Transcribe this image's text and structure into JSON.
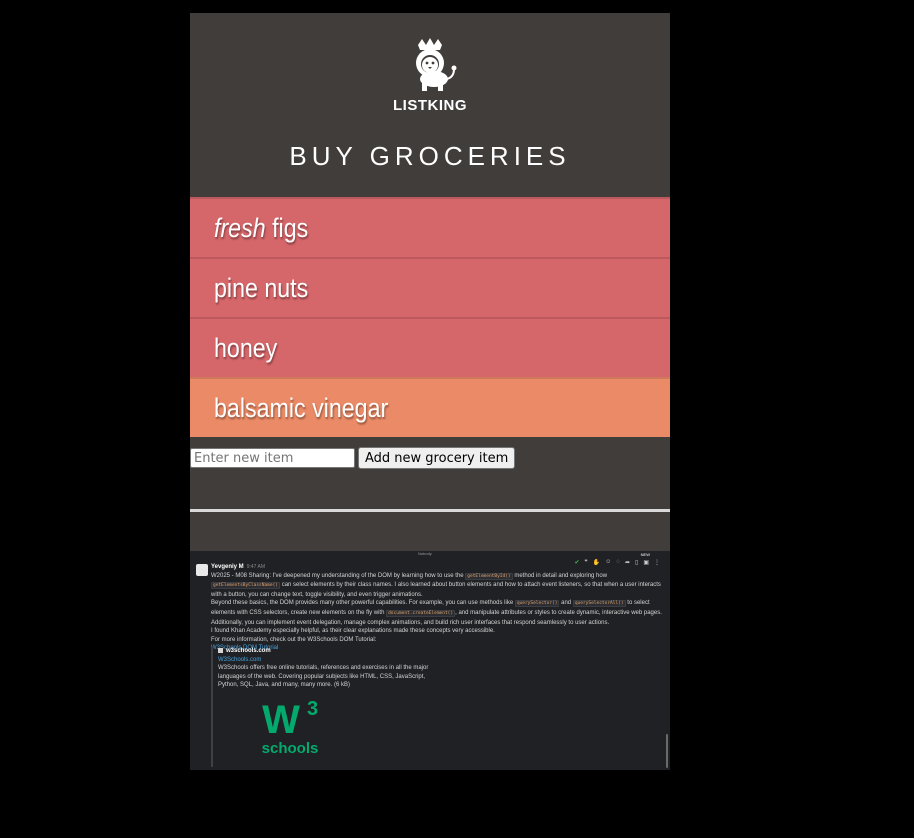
{
  "app": {
    "brand": "LISTKING",
    "title": "BUY GROCERIES",
    "items": [
      {
        "prefix": "fresh",
        "label": " figs",
        "color": "#d5666a"
      },
      {
        "prefix": "",
        "label": "pine nuts",
        "color": "#d5666a"
      },
      {
        "prefix": "",
        "label": "honey",
        "color": "#d5666a"
      },
      {
        "prefix": "",
        "label": "balsamic vinegar",
        "color": "#eb8a66"
      }
    ],
    "input_placeholder": "Enter new item",
    "add_button": "Add new grocery item"
  },
  "embed": {
    "top_label": "Nobody",
    "new_tag": "NEW",
    "author": "Yevgeniy M",
    "time": "9:47 AM",
    "line1a": "W2025 - M08 Sharing: I've deepened my understanding of the DOM by learning how to use the ",
    "code1": "getElementById()",
    "line1b": " method in detail and exploring how ",
    "code2": "getElementsByClassName()",
    "line2": " can select elements by their class names. I also learned about button elements and how to attach event listeners, so that when a user interacts with a button, you can change text, toggle visibility, and even trigger animations.",
    "line3a": "Beyond these basics, the DOM provides many other powerful capabilities. For example, you can use methods like ",
    "code3": "querySelector()",
    "line3b": " and ",
    "code4": "querySelectorAll()",
    "line3c": " to select elements with CSS selectors, create new elements on the fly with ",
    "code5": "document.createElement()",
    "line3d": ", and manipulate attributes or styles to create dynamic, interactive web pages. Additionally, you can implement event delegation, manage complex animations, and build rich user interfaces that respond seamlessly to user actions.",
    "line4": "I found Khan Academy especially helpful, as their clear explanations made these concepts very accessible.",
    "line5": "For more information, check out the W3Schools DOM Tutorial:",
    "link": "W3Schools DOM Tutorial",
    "preview_site": "w3schools.com",
    "preview_title": "W3Schools.com",
    "preview_desc": "W3Schools offers free online tutorials, references and exercises in all the major languages of the web. Covering popular subjects like HTML, CSS, JavaScript, Python, SQL, Java, and many, many more. (6 kB)",
    "logo_w": "W",
    "logo_sup": "3",
    "logo_text": "schools"
  }
}
